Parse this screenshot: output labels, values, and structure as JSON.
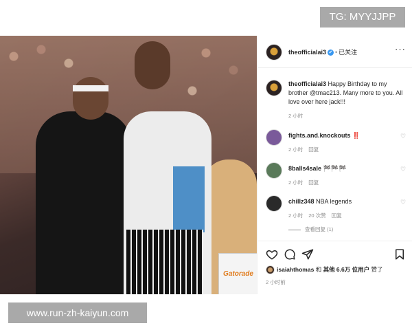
{
  "watermarks": {
    "top": "TG: MYYJJPP",
    "bottom": "www.run-zh-kaiyun.com"
  },
  "photo": {
    "sign_text": "Gatorade"
  },
  "header": {
    "username": "theofficialai3",
    "verified_mark": "✔",
    "separator": "•",
    "follow_label": "已关注",
    "more": "···"
  },
  "caption": {
    "username": "theofficialai3",
    "text": " Happy Birthday to my brother @tmac213. Many more to you. All love over here jack!!!",
    "time": "2 小时"
  },
  "comments": [
    {
      "username": "fights.and.knockouts",
      "text": " ‼️",
      "time": "2 小时",
      "likes": "",
      "reply": "回复",
      "avatar_color": "#7a5a9a"
    },
    {
      "username": "8balls4sale",
      "text": " 🏁🏁🏁",
      "time": "2 小时",
      "likes": "",
      "reply": "回复",
      "avatar_color": "#5a7a5a"
    },
    {
      "username": "chillz348",
      "text": " NBA legends",
      "time": "2 小时",
      "likes": "20 次赞",
      "reply": "回复",
      "avatar_color": "#2a2a2a"
    }
  ],
  "view_replies": "查看回复 (1)",
  "likes": {
    "user": "isaiahthomas",
    "mid": " 和 ",
    "others": "其他 6.6万 位用户",
    "tail": " 赞了"
  },
  "post_time": "2 小时前",
  "icons": {
    "like": "heart-icon",
    "comment": "comment-icon",
    "share": "send-icon",
    "save": "bookmark-icon"
  }
}
